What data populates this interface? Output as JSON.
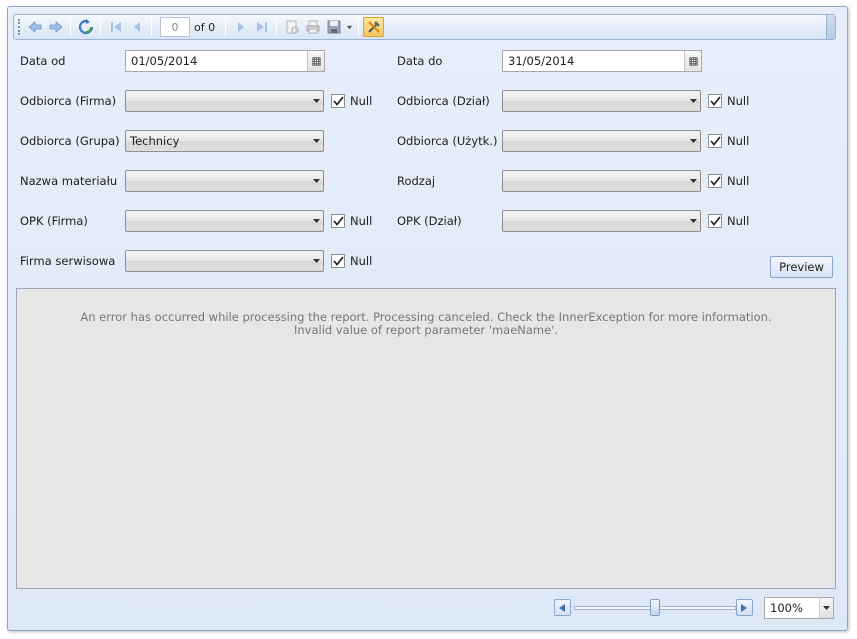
{
  "toolbar": {
    "page_value": "0",
    "page_of": "of 0",
    "icons": [
      "back-icon",
      "forward-icon",
      "refresh-icon",
      "first-page-icon",
      "previous-page-icon",
      "next-page-icon",
      "last-page-icon",
      "page-setup-icon",
      "print-icon",
      "save-icon",
      "dropdown-icon",
      "parameters-toggle-icon"
    ]
  },
  "params": {
    "date_from": {
      "label": "Data od",
      "value": "01/05/2014"
    },
    "date_to": {
      "label": "Data do",
      "value": "31/05/2014"
    },
    "recipient_company": {
      "label": "Odbiorca (Firma)",
      "value": "",
      "null_label": "Null",
      "null_checked": true
    },
    "recipient_department": {
      "label": "Odbiorca (Dział)",
      "value": "",
      "null_label": "Null",
      "null_checked": true
    },
    "recipient_group": {
      "label": "Odbiorca (Grupa)",
      "value": "Technicy"
    },
    "recipient_user": {
      "label": "Odbiorca (Użytk.)",
      "value": "",
      "null_label": "Null",
      "null_checked": true
    },
    "material_name": {
      "label": "Nazwa materiału",
      "value": ""
    },
    "type": {
      "label": "Rodzaj",
      "value": "",
      "null_label": "Null",
      "null_checked": true
    },
    "opk_company": {
      "label": "OPK (Firma)",
      "value": "",
      "null_label": "Null",
      "null_checked": true
    },
    "opk_department": {
      "label": "OPK (Dział)",
      "value": "",
      "null_label": "Null",
      "null_checked": true
    },
    "service_company": {
      "label": "Firma serwisowa",
      "value": "",
      "null_label": "Null",
      "null_checked": true
    },
    "preview_label": "Preview"
  },
  "report": {
    "error_line1": "An error has occurred while processing the report. Processing canceled. Check the InnerException for more information.",
    "error_line2": "Invalid value of report parameter 'maeName'."
  },
  "zoom": {
    "value": "100%",
    "slider_level": 0.5
  }
}
